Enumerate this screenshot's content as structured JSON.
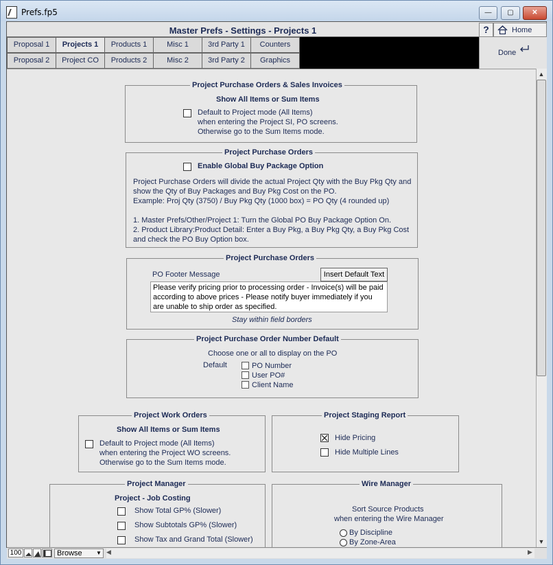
{
  "window": {
    "title": "Prefs.fp5",
    "min_glyph": "—",
    "max_glyph": "▢",
    "close_glyph": "✕"
  },
  "header": {
    "title": "Master Prefs - Settings - Projects 1",
    "help_label": "?",
    "home_label": "Home",
    "done_label": "Done"
  },
  "tabs": {
    "row1": [
      "Proposal 1",
      "Projects 1",
      "Products 1",
      "Misc 1",
      "3rd Party 1",
      "Counters"
    ],
    "row2": [
      "Proposal 2",
      "Project CO",
      "Products 2",
      "Misc 2",
      "3rd Party 2",
      "Graphics"
    ],
    "active": "Projects 1"
  },
  "sec_po_si": {
    "title": "Project Purchase Orders & Sales Invoices",
    "subtitle": "Show All Items or Sum Items",
    "checkbox_line1": "Default to Project mode (All Items)",
    "checkbox_line2": "when entering the Project SI, PO screens.",
    "checkbox_line3": "Otherwise go to the Sum Items mode.",
    "checked": false
  },
  "sec_po_buy": {
    "title": "Project Purchase Orders",
    "checkbox_label": "Enable Global Buy Package Option",
    "checked": false,
    "lines": [
      "Project Purchase Orders will divide the actual Project Qty with the Buy Pkg Qty and",
      "show the Qty of Buy Packages and Buy Pkg Cost on the PO.",
      "Example:  Proj Qty (3750)  / Buy Pkg Qty (1000 box)  = PO Qty (4 rounded up)",
      "1. Master Prefs/Other/Project 1: Turn the Global PO Buy Package Option On.",
      "2. Product Library:Product Detail: Enter a Buy Pkg, a Buy Pkg Qty, a Buy Pkg Cost",
      "and check the PO Buy Option box."
    ]
  },
  "sec_po_footer": {
    "title": "Project Purchase Orders",
    "label": "PO Footer Message",
    "button": "Insert Default Text",
    "message": "Please verify pricing prior to processing order - Invoice(s) will be paid according to above prices - Please notify buyer immediately if you are unable to ship order as specified.",
    "hint": "Stay within field borders"
  },
  "sec_po_number": {
    "title": "Project Purchase Order Number Default",
    "subtitle": "Choose one or all to display on the PO",
    "default_label": "Default",
    "options": [
      "PO Number",
      "User PO#",
      "Client Name"
    ]
  },
  "sec_wo": {
    "title": "Project Work Orders",
    "subtitle": "Show All Items or Sum Items",
    "checkbox_line1": "Default to Project mode (All Items)",
    "checkbox_line2": "when entering the Project WO screens.",
    "checkbox_line3": "Otherwise go to the Sum Items mode.",
    "checked": false
  },
  "sec_staging": {
    "title": "Project Staging Report",
    "options": [
      {
        "label": "Hide Pricing",
        "checked": true
      },
      {
        "label": "Hide Multiple Lines",
        "checked": false
      }
    ]
  },
  "sec_pm": {
    "title": "Project Manager",
    "subtitle": "Project - Job Costing",
    "options": [
      "Show Total GP% (Slower)",
      "Show Subtotals GP% (Slower)",
      "Show Tax and Grand Total (Slower)"
    ]
  },
  "sec_wire": {
    "title": "Wire Manager",
    "line1": "Sort Source Products",
    "line2": "when entering the Wire Manager",
    "options": [
      "By Discipline",
      "By Zone-Area"
    ]
  },
  "status": {
    "zoom": "100",
    "mode": "Browse"
  },
  "colors": {
    "panel": "#e8e8e8",
    "text": "#1c2a55",
    "tab_strip_fill": "#000000",
    "titlebar": "#c9d9ea",
    "close": "#c94a32"
  }
}
